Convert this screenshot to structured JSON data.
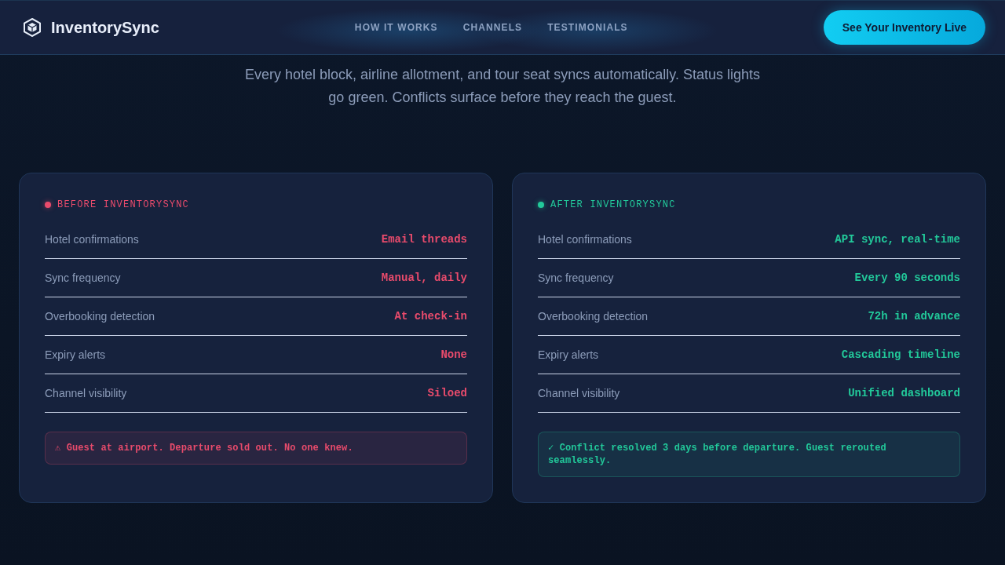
{
  "nav": {
    "brand": "InventorySync",
    "links": [
      "HOW IT WORKS",
      "CHANNELS",
      "TESTIMONIALS"
    ],
    "cta": "See Your Inventory Live"
  },
  "hero": {
    "text": "Every hotel block, airline allotment, and tour seat syncs automatically. Status lights go green. Conflicts surface before they reach the guest."
  },
  "comparison": [
    {
      "title": "BEFORE INVENTORYSYNC",
      "color": "#e94b6c",
      "rows": [
        {
          "label": "Hotel confirmations",
          "value": "Email threads"
        },
        {
          "label": "Sync frequency",
          "value": "Manual, daily"
        },
        {
          "label": "Overbooking detection",
          "value": "At check-in"
        },
        {
          "label": "Expiry alerts",
          "value": "None"
        },
        {
          "label": "Channel visibility",
          "value": "Siloed"
        }
      ],
      "callout": "⚠ Guest at airport. Departure sold out. No one knew."
    },
    {
      "title": "AFTER INVENTORYSYNC",
      "color": "#22c99a",
      "rows": [
        {
          "label": "Hotel confirmations",
          "value": "API sync, real-time"
        },
        {
          "label": "Sync frequency",
          "value": "Every 90 seconds"
        },
        {
          "label": "Overbooking detection",
          "value": "72h in advance"
        },
        {
          "label": "Expiry alerts",
          "value": "Cascading timeline"
        },
        {
          "label": "Channel visibility",
          "value": "Unified dashboard"
        }
      ],
      "callout": "✓ Conflict resolved 3 days before departure. Guest rerouted seamlessly."
    }
  ]
}
